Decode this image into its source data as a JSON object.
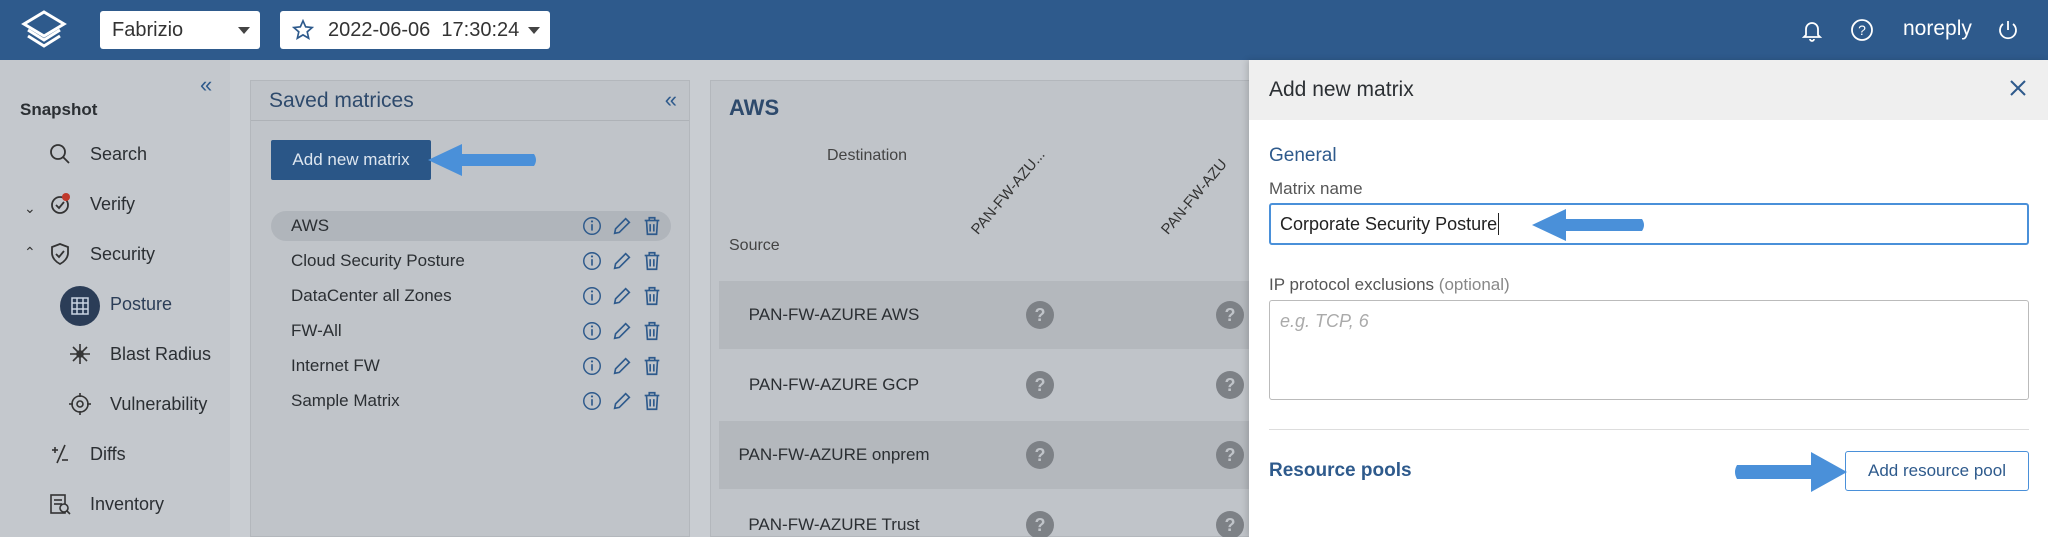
{
  "topbar": {
    "workspace": "Fabrizio",
    "snapshot": "2022-06-06  17:30:24",
    "user": "noreply"
  },
  "nav": {
    "title": "Snapshot",
    "items": {
      "search": "Search",
      "verify": "Verify",
      "security": "Security",
      "posture": "Posture",
      "blast": "Blast Radius",
      "vuln": "Vulnerability",
      "diffs": "Diffs",
      "inventory": "Inventory"
    }
  },
  "saved": {
    "title": "Saved matrices",
    "add_label": "Add new matrix",
    "matrices": [
      "AWS",
      "Cloud Security Posture",
      "DataCenter all Zones",
      "FW-All",
      "Internet FW",
      "Sample Matrix"
    ]
  },
  "aws": {
    "title": "AWS",
    "destination": "Destination",
    "source": "Source",
    "columns": [
      "PAN-FW-AZU...",
      "PAN-FW-AZU"
    ],
    "rows": [
      "PAN-FW-AZURE AWS",
      "PAN-FW-AZURE GCP",
      "PAN-FW-AZURE onprem",
      "PAN-FW-AZURE Trust"
    ],
    "cell": "?"
  },
  "drawer": {
    "title": "Add new matrix",
    "general": "General",
    "name_label": "Matrix name",
    "name_value": "Corporate Security Posture",
    "ip_label": "IP protocol exclusions",
    "ip_optional": "(optional)",
    "ip_placeholder": "e.g. TCP, 6",
    "pools_title": "Resource pools",
    "add_pool": "Add resource pool"
  },
  "colors": {
    "topbar": "#2e5a8c",
    "primary": "#2a5687",
    "arrow": "#4a90d9",
    "dim": "#c9cdd2"
  }
}
